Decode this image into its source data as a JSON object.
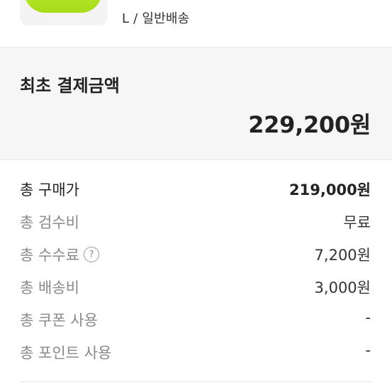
{
  "product": {
    "option_text": "L / 일반배송"
  },
  "summary": {
    "title": "최초 결제금액",
    "amount": "229,200원"
  },
  "rows": [
    {
      "label": "총 구매가",
      "value": "219,000원"
    },
    {
      "label": "총 검수비",
      "value": "무료"
    },
    {
      "label": "총 수수료",
      "value": "7,200원",
      "help": "?"
    },
    {
      "label": "총 배송비",
      "value": "3,000원"
    },
    {
      "label": "총 쿠폰 사용",
      "value": "-"
    },
    {
      "label": "총 포인트 사용",
      "value": "-"
    }
  ],
  "colors": {
    "summary_background": "#f6f6f6",
    "thumbnail_item": "#a6dc19"
  }
}
